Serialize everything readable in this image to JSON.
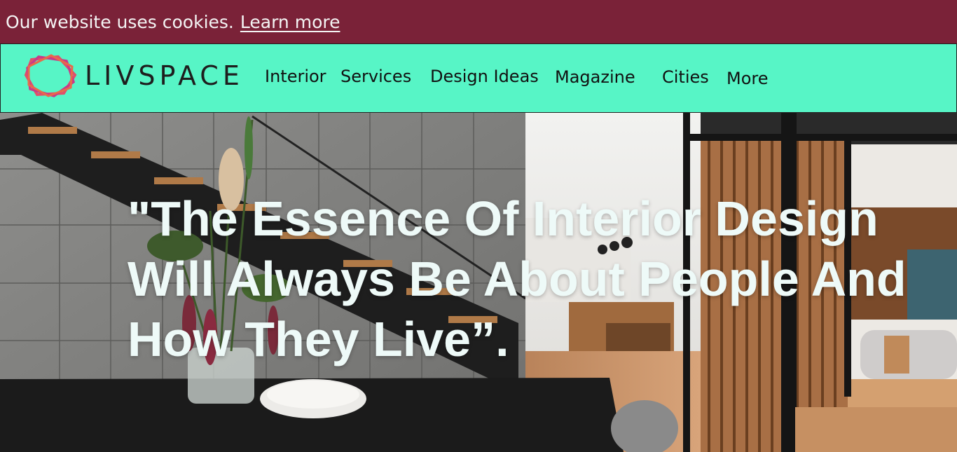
{
  "cookie": {
    "message": "Our website uses cookies.",
    "link_label": "Learn more"
  },
  "brand": {
    "name": "LIVSPACE",
    "logo_icon": "livspace-logo-icon"
  },
  "nav": {
    "items": [
      {
        "label": "Interior"
      },
      {
        "label": "Services"
      },
      {
        "label": "Design Ideas"
      },
      {
        "label": "Magazine"
      },
      {
        "label": "Cities"
      },
      {
        "label": "More"
      }
    ]
  },
  "hero": {
    "quote": "\"The Essence Of Interior Design Will Always Be About People And How They Live”."
  },
  "colors": {
    "cookie_bar": "#7a2238",
    "navbar": "#57f5c6",
    "quote_text": "#eefaf8"
  }
}
